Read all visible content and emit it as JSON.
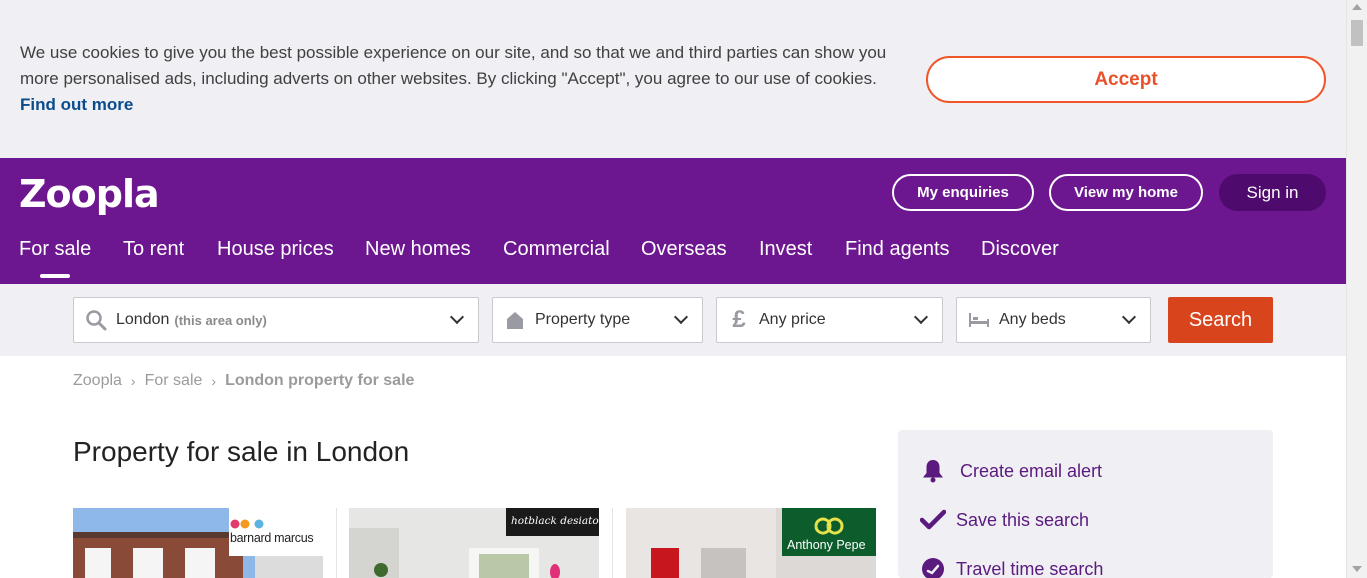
{
  "cookie_banner": {
    "message": "We use cookies to give you the best possible experience on our site, and so that we and third parties can show you more personalised ads, including adverts on other websites. By clicking \"Accept\", you agree to our use of cookies.",
    "link": "Find out more",
    "accept_label": "Accept"
  },
  "header": {
    "logo": "Zoopla",
    "buttons": {
      "enquiries": "My enquiries",
      "view_home": "View my home",
      "sign_in": "Sign in"
    },
    "nav": [
      "For sale",
      "To rent",
      "House prices",
      "New homes",
      "Commercial",
      "Overseas",
      "Invest",
      "Find agents",
      "Discover"
    ],
    "active_nav": "For sale",
    "brand_color": "#6c168f"
  },
  "search": {
    "location": "London",
    "location_hint": "(this area only)",
    "property_type": "Property type",
    "price": "Any price",
    "beds": "Any beds",
    "button": "Search",
    "button_color": "#d8441c"
  },
  "breadcrumb": [
    "Zoopla",
    "For sale",
    "London property for sale"
  ],
  "page_title": "Property for sale in London",
  "listings": [
    {
      "agent": "barnard marcus"
    },
    {
      "agent": "hotblack desiato"
    },
    {
      "agent": "Anthony Pepe"
    }
  ],
  "sidebar": {
    "items": [
      "Create email alert",
      "Save this search",
      "Travel time search"
    ]
  }
}
